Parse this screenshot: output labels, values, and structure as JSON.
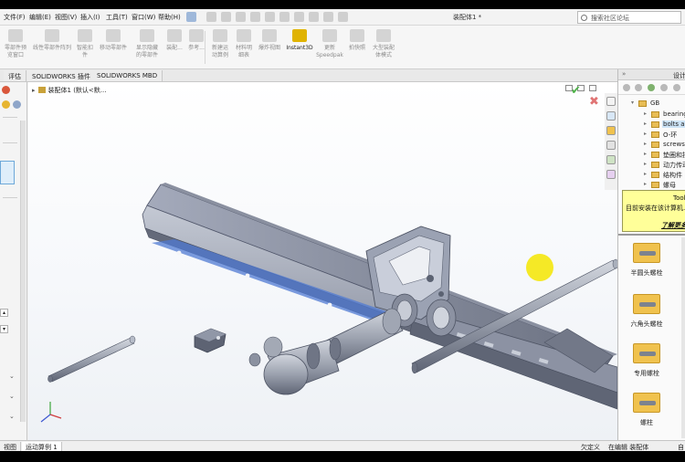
{
  "menu": {
    "items": [
      "文件(F)",
      "编辑(E)",
      "视图(V)",
      "插入(I)",
      "工具(T)",
      "窗口(W)",
      "帮助(H)"
    ],
    "doc_title": "装配体1 *",
    "search_placeholder": "搜索社区论坛"
  },
  "ribbon": {
    "buttons": [
      {
        "label": "零部件预\n览窗口",
        "active": false
      },
      {
        "label": "线性零部件阵列",
        "active": false
      },
      {
        "label": "智能扣\n件",
        "active": false
      },
      {
        "label": "移动零部件",
        "active": false
      },
      {
        "label": "显示隐藏\n的零部件",
        "active": false
      },
      {
        "label": "装配...",
        "active": false
      },
      {
        "label": "参考...",
        "active": false
      },
      {
        "label": "新建运\n动算例",
        "active": false
      },
      {
        "label": "材料明\n细表",
        "active": false
      },
      {
        "label": "爆炸视图",
        "active": false
      },
      {
        "label": "Instant3D",
        "active": true
      },
      {
        "label": "更新\nSpeedpak",
        "active": false
      },
      {
        "label": "拍快照",
        "active": false
      },
      {
        "label": "大型装配\n体模式",
        "active": false
      }
    ]
  },
  "command_tabs": [
    "评估",
    "SOLIDWORKS 插件",
    "SOLIDWORKS MBD"
  ],
  "viewport": {
    "tree_header": "装配体1 (默认<默..."
  },
  "design_library": {
    "title": "设计库",
    "tree": [
      {
        "label": "GB",
        "expanded": true,
        "selected": false
      },
      {
        "label": "bearing",
        "expanded": false,
        "selected": false
      },
      {
        "label": "bolts and studs",
        "expanded": false,
        "selected": true
      },
      {
        "label": "O-环",
        "expanded": false,
        "selected": false
      },
      {
        "label": "screws",
        "expanded": false,
        "selected": false
      },
      {
        "label": "垫圈和挡圈",
        "expanded": false,
        "selected": false
      },
      {
        "label": "动力传动",
        "expanded": false,
        "selected": false
      },
      {
        "label": "结构件",
        "expanded": false,
        "selected": false
      },
      {
        "label": "螺母",
        "expanded": false,
        "selected": false
      }
    ],
    "toolbox_title": "Toolbox",
    "toolbox_msg": "目前安装在该计算机...",
    "toolbox_link": "了解更多",
    "fasteners": [
      {
        "label": "半圆头螺栓"
      },
      {
        "label": "六角头螺栓"
      },
      {
        "label": "专用螺栓"
      },
      {
        "label": "螺柱"
      }
    ]
  },
  "bottom_tabs": [
    "视图",
    "运动算例 1"
  ],
  "status": {
    "items": [
      "欠定义",
      "在编辑 装配体",
      "自"
    ]
  },
  "colors": {
    "part_fill": "#7f8595",
    "part_dark": "#5a6070",
    "part_light": "#b7bdc9",
    "highlight": "#4f79d3",
    "halo": "#f5e600"
  }
}
